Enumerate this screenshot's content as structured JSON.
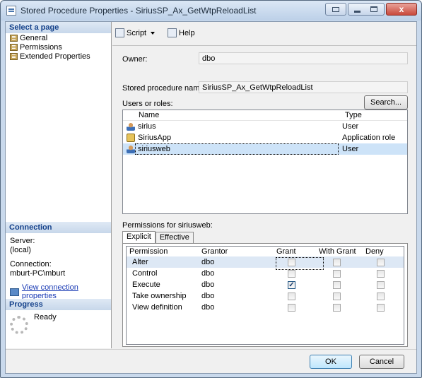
{
  "window": {
    "title": "Stored Procedure Properties - SiriusSP_Ax_GetWtpReloadList",
    "close_glyph": "x"
  },
  "left": {
    "select_page_header": "Select a page",
    "pages": [
      {
        "label": "General"
      },
      {
        "label": "Permissions"
      },
      {
        "label": "Extended Properties"
      }
    ],
    "connection_header": "Connection",
    "server_label": "Server:",
    "server_value": "(local)",
    "connection_label": "Connection:",
    "connection_value": "mburt-PC\\mburt",
    "view_conn_link": "View connection properties",
    "progress_header": "Progress",
    "progress_status": "Ready"
  },
  "toolbar": {
    "script_label": "Script",
    "help_label": "Help"
  },
  "form": {
    "owner_label": "Owner:",
    "owner_value": "dbo",
    "sp_name_label": "Stored procedure name:",
    "sp_name_value": "SiriusSP_Ax_GetWtpReloadList",
    "users_label": "Users or roles:",
    "search_button": "Search...",
    "users_columns": {
      "name": "Name",
      "type": "Type"
    },
    "users": [
      {
        "name": "sirius",
        "type": "User",
        "icon": "user-icon"
      },
      {
        "name": "SiriusApp",
        "type": "Application role",
        "icon": "app-role-icon"
      },
      {
        "name": "siriusweb",
        "type": "User",
        "icon": "user-icon"
      }
    ],
    "permissions_label": "Permissions for siriusweb:",
    "tabs": [
      {
        "label": "Explicit"
      },
      {
        "label": "Effective"
      }
    ],
    "perm_columns": {
      "permission": "Permission",
      "grantor": "Grantor",
      "grant": "Grant",
      "with_grant": "With Grant",
      "deny": "Deny"
    },
    "permissions": [
      {
        "permission": "Alter",
        "grantor": "dbo",
        "grant": false,
        "with_grant": false,
        "deny": false
      },
      {
        "permission": "Control",
        "grantor": "dbo",
        "grant": false,
        "with_grant": false,
        "deny": false
      },
      {
        "permission": "Execute",
        "grantor": "dbo",
        "grant": true,
        "with_grant": false,
        "deny": false
      },
      {
        "permission": "Take ownership",
        "grantor": "dbo",
        "grant": false,
        "with_grant": false,
        "deny": false
      },
      {
        "permission": "View definition",
        "grantor": "dbo",
        "grant": false,
        "with_grant": false,
        "deny": false
      }
    ],
    "check_mark": "✓"
  },
  "footer": {
    "ok_label": "OK",
    "cancel_label": "Cancel"
  }
}
